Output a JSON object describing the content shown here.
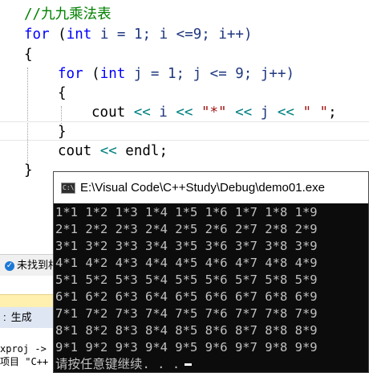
{
  "editor": {
    "lines": [
      {
        "text": "//九九乘法表"
      },
      {
        "kw_for": "for",
        "open": " (",
        "kw_int": "int",
        "rest": " i = 1; i <=9; i++)"
      },
      {
        "text": "{"
      },
      {
        "kw_for": "for",
        "open": " (",
        "kw_int": "int",
        "rest": " j = 1; j <= 9; j++)"
      },
      {
        "text": "{"
      },
      {
        "cout": "cout ",
        "op1": "<<",
        "v1": " i ",
        "op2": "<<",
        "s1": " \"*\" ",
        "op3": "<<",
        "v2": " j ",
        "op4": "<<",
        "s2": " \" \"",
        "end": ";"
      },
      {
        "text": "}"
      },
      {
        "cout": "cout ",
        "op1": "<<",
        "endl": " endl;"
      },
      {
        "text": "}"
      }
    ]
  },
  "left_panels": {
    "error_list_text": "未找到相关问题",
    "output_label": "生成",
    "output_lines": [
      "xproj ->",
      "项目 \"C++"
    ]
  },
  "console": {
    "icon_text": "C:\\",
    "title": "E:\\Visual Code\\C++Study\\Debug\\demo01.exe",
    "lines": [
      "1*1 1*2 1*3 1*4 1*5 1*6 1*7 1*8 1*9",
      "2*1 2*2 2*3 2*4 2*5 2*6 2*7 2*8 2*9",
      "3*1 3*2 3*3 3*4 3*5 3*6 3*7 3*8 3*9",
      "4*1 4*2 4*3 4*4 4*5 4*6 4*7 4*8 4*9",
      "5*1 5*2 5*3 5*4 5*5 5*6 5*7 5*8 5*9",
      "6*1 6*2 6*3 6*4 6*5 6*6 6*7 6*8 6*9",
      "7*1 7*2 7*3 7*4 7*5 7*6 7*7 7*8 7*9",
      "8*1 8*2 8*3 8*4 8*5 8*6 8*7 8*8 8*9",
      "9*1 9*2 9*3 9*4 9*5 9*6 9*7 9*8 9*9"
    ],
    "prompt": "请按任意键继续. . ."
  },
  "colors": {
    "keyword": "#0000ff",
    "comment": "#008000",
    "string": "#a31515",
    "operator": "#008080",
    "console_bg": "#0c0c0c",
    "console_text": "#c0c0c0"
  }
}
